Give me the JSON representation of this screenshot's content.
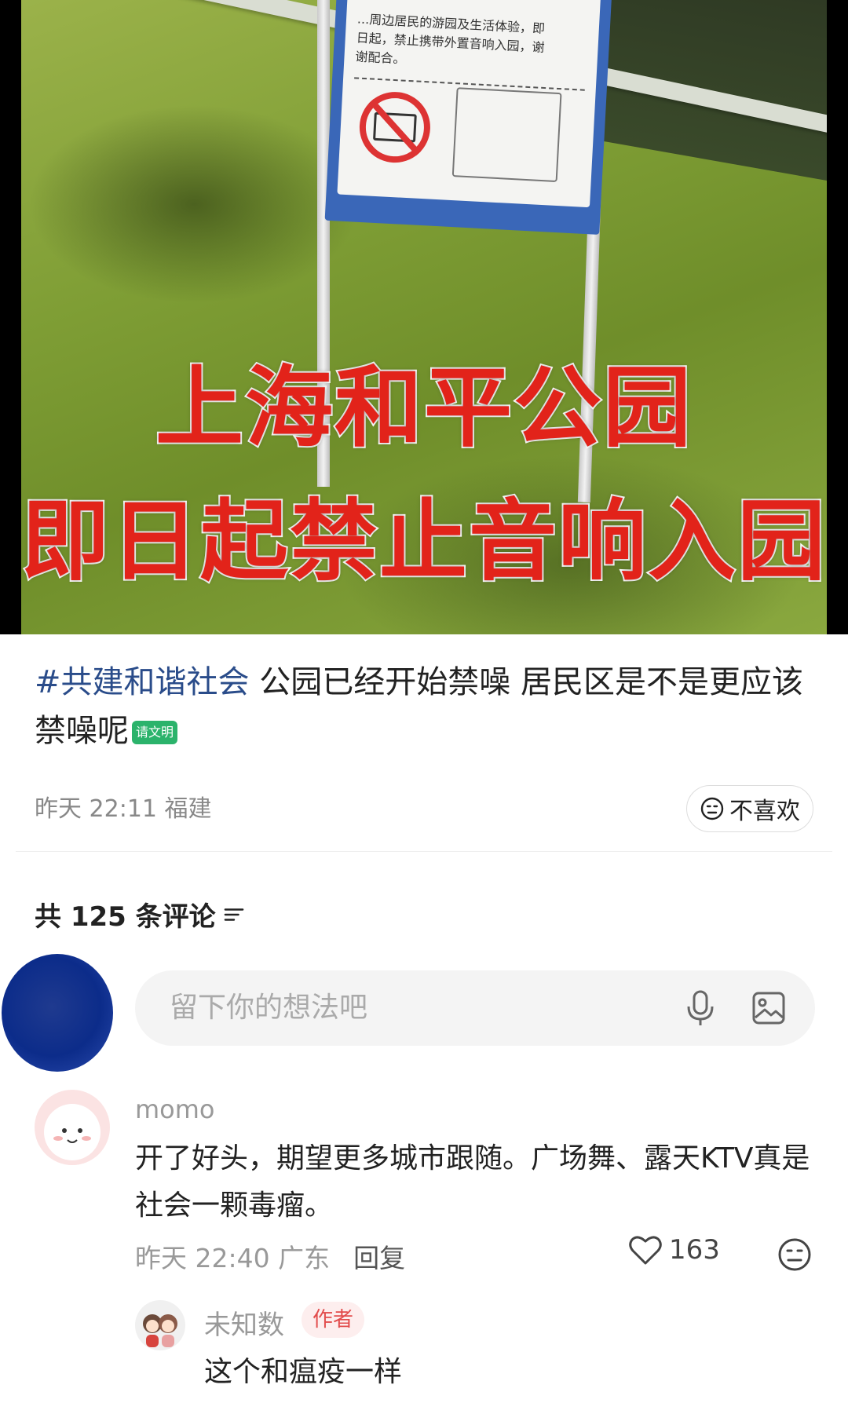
{
  "photo": {
    "headline_line1": "上海和平公园",
    "headline_line2": "即日起禁止音响入园",
    "sign_text": "...周边居民的游园及生活体验，即日起，禁止携带外置音响入园，谢谢配合。"
  },
  "post": {
    "hashtag": "#共建和谐社会",
    "body": " 公园已经开始禁噪 居民区是不是更应该禁噪呢",
    "emoji_badge": "请文明",
    "time": "昨天 22:11",
    "location": "福建",
    "dislike_label": "不喜欢"
  },
  "comments_header": {
    "count_label": "共 125 条评论"
  },
  "input": {
    "placeholder": "留下你的想法吧"
  },
  "comment": {
    "author": "momo",
    "text": "开了好头，期望更多城市跟随。广场舞、露天KTV真是社会一颗毒瘤。",
    "time": "昨天 22:40",
    "location": "广东",
    "reply_label": "回复",
    "likes": "163"
  },
  "reply": {
    "author": "未知数",
    "badge": "作者",
    "text": "这个和瘟疫一样"
  },
  "colors": {
    "headline_red": "#e2231a",
    "hashtag_blue": "#2a4c8a",
    "author_badge_red": "#e24c4c"
  }
}
